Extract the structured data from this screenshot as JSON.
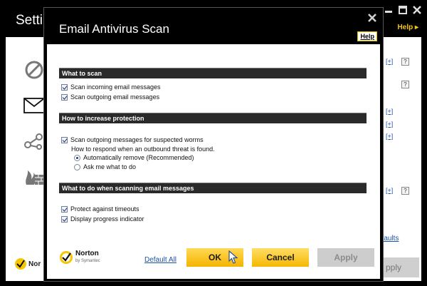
{
  "background": {
    "title": "Settin",
    "help_label": "Help ▸",
    "defaults_link": "efaults",
    "apply_label": "pply",
    "norton_fragment": "Nor",
    "expand_label": "[+]",
    "question_label": "?"
  },
  "dialog": {
    "title": "Email Antivirus Scan",
    "help_label": "Help",
    "sections": [
      {
        "header": "What to scan"
      },
      {
        "header": "How to increase protection"
      },
      {
        "header": "What to do when scanning email messages"
      }
    ],
    "scan_incoming": {
      "label": "Scan incoming email messages",
      "checked": true
    },
    "scan_outgoing": {
      "label": "Scan outgoing email messages",
      "checked": true
    },
    "scan_worms": {
      "label": "Scan outgoing messages for suspected worms",
      "checked": true
    },
    "respond_text": "How to respond when an outbound threat is found.",
    "radio_auto": {
      "label": "Automatically remove (Recommended)",
      "selected": true
    },
    "radio_ask": {
      "label": "Ask me what to do",
      "selected": false
    },
    "protect_timeouts": {
      "label": "Protect against timeouts",
      "checked": true
    },
    "progress_indicator": {
      "label": "Display progress indicator",
      "checked": true
    },
    "norton": {
      "name": "Norton",
      "sub": "by Symantec"
    },
    "default_all": "Default All",
    "ok_label": "OK",
    "cancel_label": "Cancel",
    "apply_label": "Apply"
  },
  "colors": {
    "accent_yellow": "#f4b400",
    "link_blue": "#1a52a8",
    "section_bar": "#2a2a2a"
  }
}
